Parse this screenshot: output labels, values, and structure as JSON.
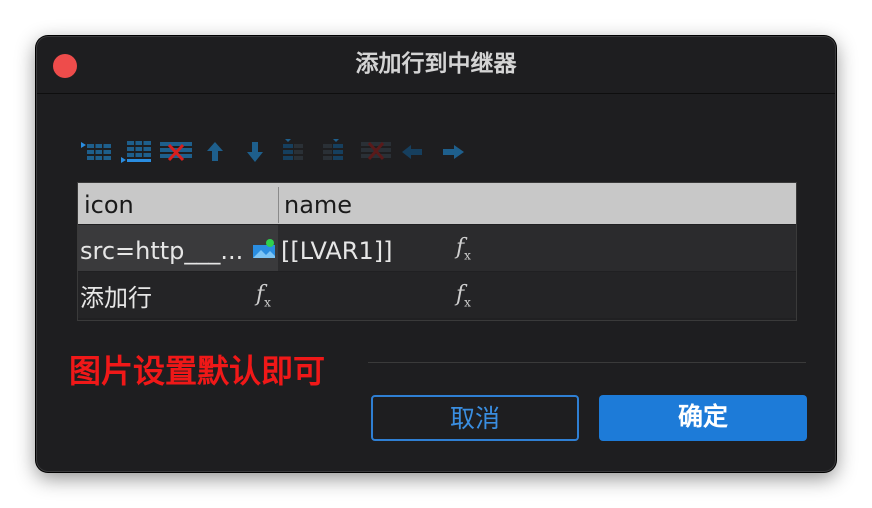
{
  "dialog": {
    "title": "添加行到中继器",
    "close_color": "#ee4c4b"
  },
  "toolbar": {
    "icons": [
      "insert-row-above-icon",
      "insert-row-below-icon",
      "delete-row-icon",
      "move-up-icon",
      "move-down-icon",
      "insert-column-left-icon",
      "insert-column-right-icon",
      "delete-column-icon",
      "move-left-icon",
      "move-right-icon"
    ],
    "accent": "#1e5f8c"
  },
  "table": {
    "columns": [
      "icon",
      "name"
    ],
    "rows": [
      {
        "icon": "src=http___...",
        "name": "[[LVAR1]]"
      },
      {
        "icon": "添加行",
        "name": ""
      }
    ],
    "fx_label": "f",
    "fx_sub": "x"
  },
  "note": "图片设置默认即可",
  "buttons": {
    "cancel": "取消",
    "ok": "确定"
  },
  "colors": {
    "background": "#1e1e20",
    "header": "#c8c8c8",
    "note": "#f01818",
    "primary": "#1d7bd8"
  }
}
